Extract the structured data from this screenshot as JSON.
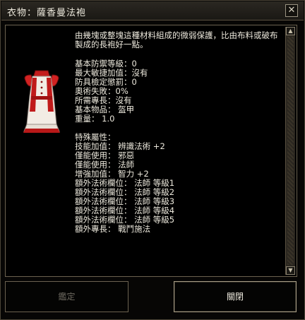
{
  "window": {
    "title": "衣物：薩香曼法袍",
    "close_glyph": "✕"
  },
  "item": {
    "icon": "robe-icon",
    "description": "由幾塊或整塊這種材料組成的微弱保護，比由布料或破布製成的長袍好一點。",
    "stats": [
      "基本防禦等級：0",
      "最大敏捷加值：沒有",
      "防具檢定懲罰：0",
      "奧術失敗：0%",
      "所需專長：沒有",
      "基本物品： 盔甲",
      "重量： 1.0"
    ],
    "properties_header": "特殊屬性：",
    "properties": [
      "技能加值： 辨識法術 +2",
      "僅能使用： 邪惡",
      "僅能使用： 法師",
      "增強加值： 智力 +2",
      "額外法術欄位： 法師 等級1",
      "額外法術欄位： 法師 等級2",
      "額外法術欄位： 法師 等級3",
      "額外法術欄位： 法師 等級4",
      "額外法術欄位： 法師 等級5",
      "額外專長： 戰鬥施法"
    ]
  },
  "buttons": {
    "identify_label": "鑑定",
    "close_label": "關閉"
  },
  "colors": {
    "text": "#ece8dc",
    "disabled_text": "#6e6a60",
    "border": "#6b6250",
    "robe_red": "#b01818",
    "robe_white": "#f2ece4"
  }
}
